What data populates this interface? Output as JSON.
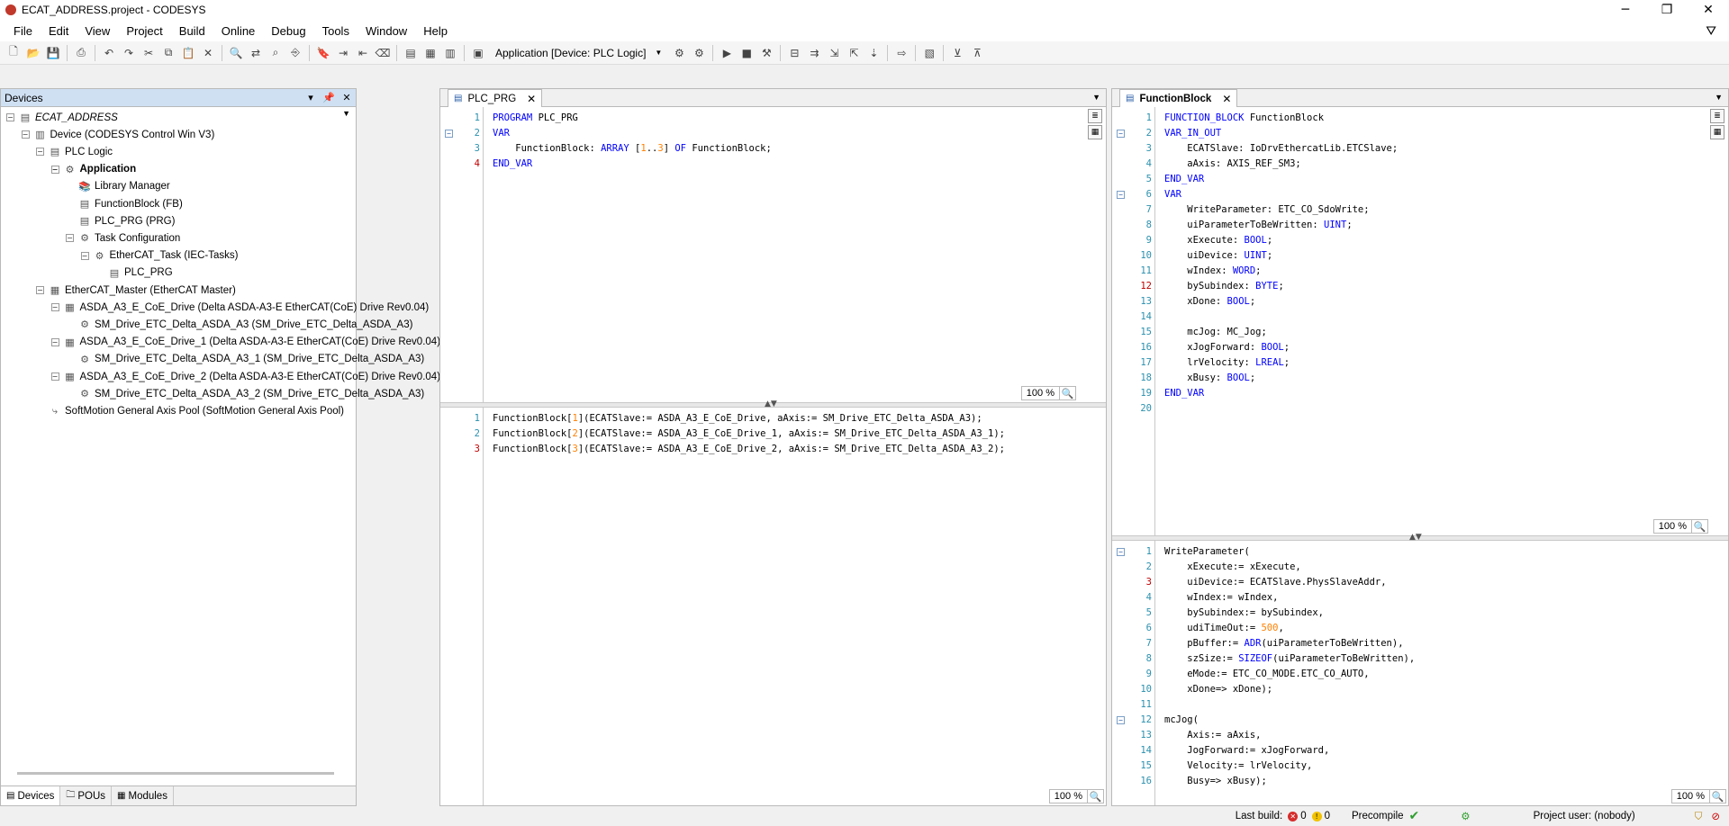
{
  "window": {
    "title": "ECAT_ADDRESS.project - CODESYS",
    "minimize": "─",
    "maximize": "❐",
    "close": "✕"
  },
  "menu": [
    "File",
    "Edit",
    "View",
    "Project",
    "Build",
    "Online",
    "Debug",
    "Tools",
    "Window",
    "Help"
  ],
  "toolbar": {
    "active_application": "Application [Device: PLC Logic]"
  },
  "devices": {
    "title": "Devices",
    "tree": [
      {
        "label": "ECAT_ADDRESS",
        "style": "ital",
        "icon": "project-icon",
        "level": 0,
        "expand": "−"
      },
      {
        "label": "Device (CODESYS Control Win V3)",
        "icon": "device-icon",
        "level": 1,
        "expand": "−"
      },
      {
        "label": "PLC Logic",
        "icon": "plc-logic-icon",
        "level": 2,
        "expand": "−"
      },
      {
        "label": "Application",
        "style": "bold",
        "icon": "application-icon",
        "level": 3,
        "expand": "−"
      },
      {
        "label": "Library Manager",
        "icon": "library-icon",
        "level": 4,
        "expand": ""
      },
      {
        "label": "FunctionBlock (FB)",
        "icon": "pou-icon",
        "level": 4,
        "expand": ""
      },
      {
        "label": "PLC_PRG (PRG)",
        "icon": "pou-icon",
        "level": 4,
        "expand": ""
      },
      {
        "label": "Task Configuration",
        "icon": "task-config-icon",
        "level": 4,
        "expand": "−"
      },
      {
        "label": "EtherCAT_Task (IEC-Tasks)",
        "icon": "task-icon",
        "level": 5,
        "expand": "−"
      },
      {
        "label": "PLC_PRG",
        "icon": "program-call-icon",
        "level": 6,
        "expand": ""
      },
      {
        "label": "EtherCAT_Master (EtherCAT Master)",
        "icon": "ethercat-master-icon",
        "level": 2,
        "expand": "−"
      },
      {
        "label": "ASDA_A3_E_CoE_Drive (Delta ASDA-A3-E EtherCAT(CoE) Drive Rev0.04)",
        "icon": "drive-icon",
        "level": 3,
        "expand": "−"
      },
      {
        "label": "SM_Drive_ETC_Delta_ASDA_A3 (SM_Drive_ETC_Delta_ASDA_A3)",
        "icon": "axis-icon",
        "level": 4,
        "expand": ""
      },
      {
        "label": "ASDA_A3_E_CoE_Drive_1 (Delta ASDA-A3-E EtherCAT(CoE) Drive Rev0.04)",
        "icon": "drive-icon",
        "level": 3,
        "expand": "−"
      },
      {
        "label": "SM_Drive_ETC_Delta_ASDA_A3_1 (SM_Drive_ETC_Delta_ASDA_A3)",
        "icon": "axis-icon",
        "level": 4,
        "expand": ""
      },
      {
        "label": "ASDA_A3_E_CoE_Drive_2 (Delta ASDA-A3-E EtherCAT(CoE) Drive Rev0.04)",
        "icon": "drive-icon",
        "level": 3,
        "expand": "−"
      },
      {
        "label": "SM_Drive_ETC_Delta_ASDA_A3_2 (SM_Drive_ETC_Delta_ASDA_A3)",
        "icon": "axis-icon",
        "level": 4,
        "expand": ""
      },
      {
        "label": "SoftMotion General Axis Pool (SoftMotion General Axis Pool)",
        "icon": "axis-pool-icon",
        "level": 2,
        "expand": ""
      }
    ],
    "tabs": [
      {
        "label": "Devices",
        "icon": "devices-icon"
      },
      {
        "label": "POUs",
        "icon": "pous-icon"
      },
      {
        "label": "Modules",
        "icon": "modules-icon"
      }
    ]
  },
  "editor_plc": {
    "tab": "PLC_PRG",
    "decl": [
      {
        "n": "1",
        "fold": "",
        "tokens": [
          [
            "kw",
            "PROGRAM"
          ],
          [
            "t",
            " PLC_PRG"
          ]
        ]
      },
      {
        "n": "2",
        "fold": "−",
        "tokens": [
          [
            "kw",
            "VAR"
          ]
        ]
      },
      {
        "n": "3",
        "fold": "",
        "tokens": [
          [
            "t",
            "    FunctionBlock: "
          ],
          [
            "kw",
            "ARRAY"
          ],
          [
            "t",
            " ["
          ],
          [
            "num",
            "1"
          ],
          [
            "t",
            ".."
          ],
          [
            "num",
            "3"
          ],
          [
            "t",
            "] "
          ],
          [
            "kw",
            "OF"
          ],
          [
            "t",
            " FunctionBlock;"
          ]
        ]
      },
      {
        "n": "4",
        "red": true,
        "fold": "",
        "tokens": [
          [
            "kw",
            "END_VAR"
          ]
        ]
      }
    ],
    "body": [
      {
        "n": "1",
        "fold": "",
        "tokens": [
          [
            "t",
            "FunctionBlock["
          ],
          [
            "num",
            "1"
          ],
          [
            "t",
            "](ECATSlave:= ASDA_A3_E_CoE_Drive, aAxis:= SM_Drive_ETC_Delta_ASDA_A3);"
          ]
        ]
      },
      {
        "n": "2",
        "fold": "",
        "tokens": [
          [
            "t",
            "FunctionBlock["
          ],
          [
            "num",
            "2"
          ],
          [
            "t",
            "](ECATSlave:= ASDA_A3_E_CoE_Drive_1, aAxis:= SM_Drive_ETC_Delta_ASDA_A3_1);"
          ]
        ]
      },
      {
        "n": "3",
        "red": true,
        "fold": "",
        "tokens": [
          [
            "t",
            "FunctionBlock["
          ],
          [
            "num",
            "3"
          ],
          [
            "t",
            "](ECATSlave:= ASDA_A3_E_CoE_Drive_2, aAxis:= SM_Drive_ETC_Delta_ASDA_A3_2);"
          ]
        ]
      }
    ],
    "zoom_top": "100 %",
    "zoom_bottom": "100 %"
  },
  "editor_fb": {
    "tab": "FunctionBlock",
    "decl": [
      {
        "n": "1",
        "fold": "",
        "tokens": [
          [
            "kw",
            "FUNCTION_BLOCK"
          ],
          [
            "t",
            " FunctionBlock"
          ]
        ]
      },
      {
        "n": "2",
        "fold": "−",
        "tokens": [
          [
            "kw",
            "VAR_IN_OUT"
          ]
        ]
      },
      {
        "n": "3",
        "fold": "",
        "tokens": [
          [
            "t",
            "    ECATSlave: IoDrvEthercatLib.ETCSlave;"
          ]
        ]
      },
      {
        "n": "4",
        "fold": "",
        "tokens": [
          [
            "t",
            "    aAxis: AXIS_REF_SM3;"
          ]
        ]
      },
      {
        "n": "5",
        "fold": "",
        "tokens": [
          [
            "kw",
            "END_VAR"
          ]
        ]
      },
      {
        "n": "6",
        "fold": "−",
        "tokens": [
          [
            "kw",
            "VAR"
          ]
        ]
      },
      {
        "n": "7",
        "fold": "",
        "tokens": [
          [
            "t",
            "    WriteParameter: ETC_CO_SdoWrite;"
          ]
        ]
      },
      {
        "n": "8",
        "fold": "",
        "tokens": [
          [
            "t",
            "    uiParameterToBeWritten: "
          ],
          [
            "kw",
            "UINT"
          ],
          [
            "t",
            ";"
          ]
        ]
      },
      {
        "n": "9",
        "fold": "",
        "tokens": [
          [
            "t",
            "    xExecute: "
          ],
          [
            "kw",
            "BOOL"
          ],
          [
            "t",
            ";"
          ]
        ]
      },
      {
        "n": "10",
        "fold": "",
        "tokens": [
          [
            "t",
            "    uiDevice: "
          ],
          [
            "kw",
            "UINT"
          ],
          [
            "t",
            ";"
          ]
        ]
      },
      {
        "n": "11",
        "fold": "",
        "tokens": [
          [
            "t",
            "    wIndex: "
          ],
          [
            "kw",
            "WORD"
          ],
          [
            "t",
            ";"
          ]
        ]
      },
      {
        "n": "12",
        "red": true,
        "fold": "",
        "tokens": [
          [
            "t",
            "    bySubindex: "
          ],
          [
            "kw",
            "BYTE"
          ],
          [
            "t",
            ";"
          ]
        ]
      },
      {
        "n": "13",
        "fold": "",
        "tokens": [
          [
            "t",
            "    xDone: "
          ],
          [
            "kw",
            "BOOL"
          ],
          [
            "t",
            ";"
          ]
        ]
      },
      {
        "n": "14",
        "fold": "",
        "tokens": []
      },
      {
        "n": "15",
        "fold": "",
        "tokens": [
          [
            "t",
            "    mcJog: MC_Jog;"
          ]
        ]
      },
      {
        "n": "16",
        "fold": "",
        "tokens": [
          [
            "t",
            "    xJogForward: "
          ],
          [
            "kw",
            "BOOL"
          ],
          [
            "t",
            ";"
          ]
        ]
      },
      {
        "n": "17",
        "fold": "",
        "tokens": [
          [
            "t",
            "    lrVelocity: "
          ],
          [
            "kw",
            "LREAL"
          ],
          [
            "t",
            ";"
          ]
        ]
      },
      {
        "n": "18",
        "fold": "",
        "tokens": [
          [
            "t",
            "    xBusy: "
          ],
          [
            "kw",
            "BOOL"
          ],
          [
            "t",
            ";"
          ]
        ]
      },
      {
        "n": "19",
        "fold": "",
        "tokens": [
          [
            "kw",
            "END_VAR"
          ]
        ]
      },
      {
        "n": "20",
        "fold": "",
        "tokens": []
      }
    ],
    "body": [
      {
        "n": "1",
        "fold": "−",
        "tokens": [
          [
            "t",
            "WriteParameter("
          ]
        ]
      },
      {
        "n": "2",
        "fold": "",
        "tokens": [
          [
            "t",
            "    xExecute:= xExecute,"
          ]
        ]
      },
      {
        "n": "3",
        "red": true,
        "fold": "",
        "tokens": [
          [
            "t",
            "    uiDevice:= ECATSlave.PhysSlaveAddr,"
          ]
        ]
      },
      {
        "n": "4",
        "fold": "",
        "tokens": [
          [
            "t",
            "    wIndex:= wIndex,"
          ]
        ]
      },
      {
        "n": "5",
        "fold": "",
        "tokens": [
          [
            "t",
            "    bySubindex:= bySubindex,"
          ]
        ]
      },
      {
        "n": "6",
        "fold": "",
        "tokens": [
          [
            "t",
            "    udiTimeOut:= "
          ],
          [
            "num",
            "500"
          ],
          [
            "t",
            ","
          ]
        ]
      },
      {
        "n": "7",
        "fold": "",
        "tokens": [
          [
            "t",
            "    pBuffer:= "
          ],
          [
            "kw",
            "ADR"
          ],
          [
            "t",
            "(uiParameterToBeWritten),"
          ]
        ]
      },
      {
        "n": "8",
        "fold": "",
        "tokens": [
          [
            "t",
            "    szSize:= "
          ],
          [
            "kw",
            "SIZEOF"
          ],
          [
            "t",
            "(uiParameterToBeWritten),"
          ]
        ]
      },
      {
        "n": "9",
        "fold": "",
        "tokens": [
          [
            "t",
            "    eMode:= ETC_CO_MODE.ETC_CO_AUTO,"
          ]
        ]
      },
      {
        "n": "10",
        "fold": "",
        "tokens": [
          [
            "t",
            "    xDone=> xDone);"
          ]
        ]
      },
      {
        "n": "11",
        "fold": "",
        "tokens": []
      },
      {
        "n": "12",
        "fold": "−",
        "tokens": [
          [
            "t",
            "mcJog("
          ]
        ]
      },
      {
        "n": "13",
        "fold": "",
        "tokens": [
          [
            "t",
            "    Axis:= aAxis,"
          ]
        ]
      },
      {
        "n": "14",
        "fold": "",
        "tokens": [
          [
            "t",
            "    JogForward:= xJogForward,"
          ]
        ]
      },
      {
        "n": "15",
        "fold": "",
        "tokens": [
          [
            "t",
            "    Velocity:= lrVelocity,"
          ]
        ]
      },
      {
        "n": "16",
        "fold": "",
        "tokens": [
          [
            "t",
            "    Busy=> xBusy);"
          ]
        ]
      }
    ],
    "zoom_top": "100 %",
    "zoom_bottom": "100 %"
  },
  "status": {
    "last_build_label": "Last build:",
    "errors": "0",
    "warnings": "0",
    "precompile_label": "Precompile",
    "project_user": "Project user: (nobody)"
  }
}
